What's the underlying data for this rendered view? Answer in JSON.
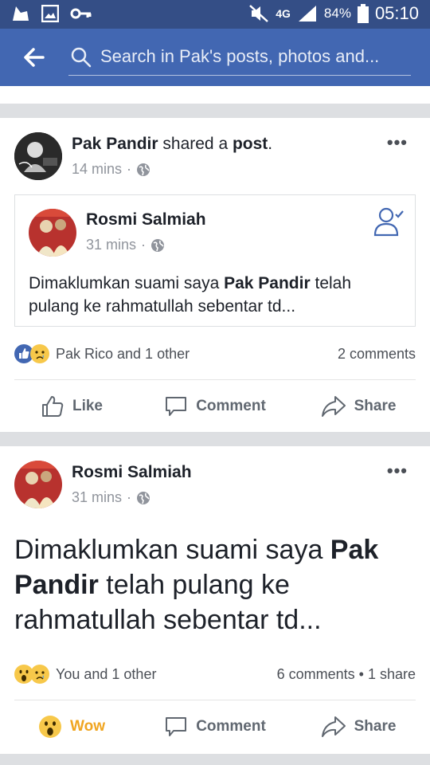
{
  "status_bar": {
    "network": "4G",
    "battery": "84%",
    "time": "05:10"
  },
  "search": {
    "placeholder": "Search in Pak's posts, photos and..."
  },
  "post1": {
    "author": "Pak Pandir",
    "verb": " shared a ",
    "object": "post",
    "period": ".",
    "time": "14 mins",
    "more": "•••",
    "shared": {
      "author": "Rosmi Salmiah",
      "time": "31 mins",
      "text_pre": "Dimaklumkan suami saya ",
      "text_bold": "Pak Pandir",
      "text_post": " telah pulang ke rahmatullah sebentar td..."
    },
    "reactions_text": "Pak Rico and 1 other",
    "counts": "2 comments",
    "actions": [
      "Like",
      "Comment",
      "Share"
    ]
  },
  "post2": {
    "author": "Rosmi Salmiah",
    "time": "31 mins",
    "more": "•••",
    "text_pre": "Dimaklumkan suami saya ",
    "text_bold": "Pak Pandir",
    "text_post": " telah pulang ke rahmatullah sebentar td...",
    "reactions_text": "You and 1 other",
    "counts": "6 comments • 1 share",
    "actions": [
      "Wow",
      "Comment",
      "Share"
    ]
  },
  "colors": {
    "header": "#4267b2",
    "status": "#344e86",
    "like_blue": "#4267b2",
    "wow_yellow": "#f0a520"
  }
}
